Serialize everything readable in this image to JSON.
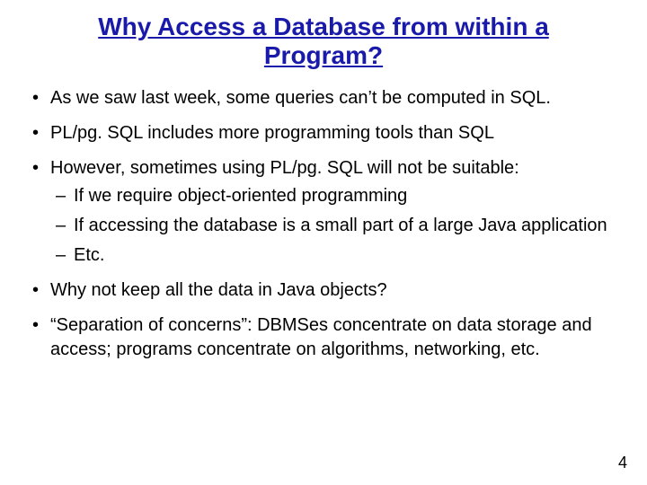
{
  "title": "Why Access a Database from within a Program?",
  "bullets": [
    {
      "text": "As we saw last week, some queries can’t be computed in SQL."
    },
    {
      "text": "PL/pg. SQL includes more programming tools than SQL"
    },
    {
      "text": "However, sometimes using PL/pg. SQL will not be suitable:",
      "sub": [
        "If we require object-oriented programming",
        "If accessing the database is a small part of a large Java application",
        "Etc."
      ]
    },
    {
      "text": "Why not keep all the data in Java objects?"
    },
    {
      "text": "“Separation of concerns”: DBMSes concentrate on data storage and access; programs concentrate on algorithms, networking, etc."
    }
  ],
  "page_number": "4"
}
